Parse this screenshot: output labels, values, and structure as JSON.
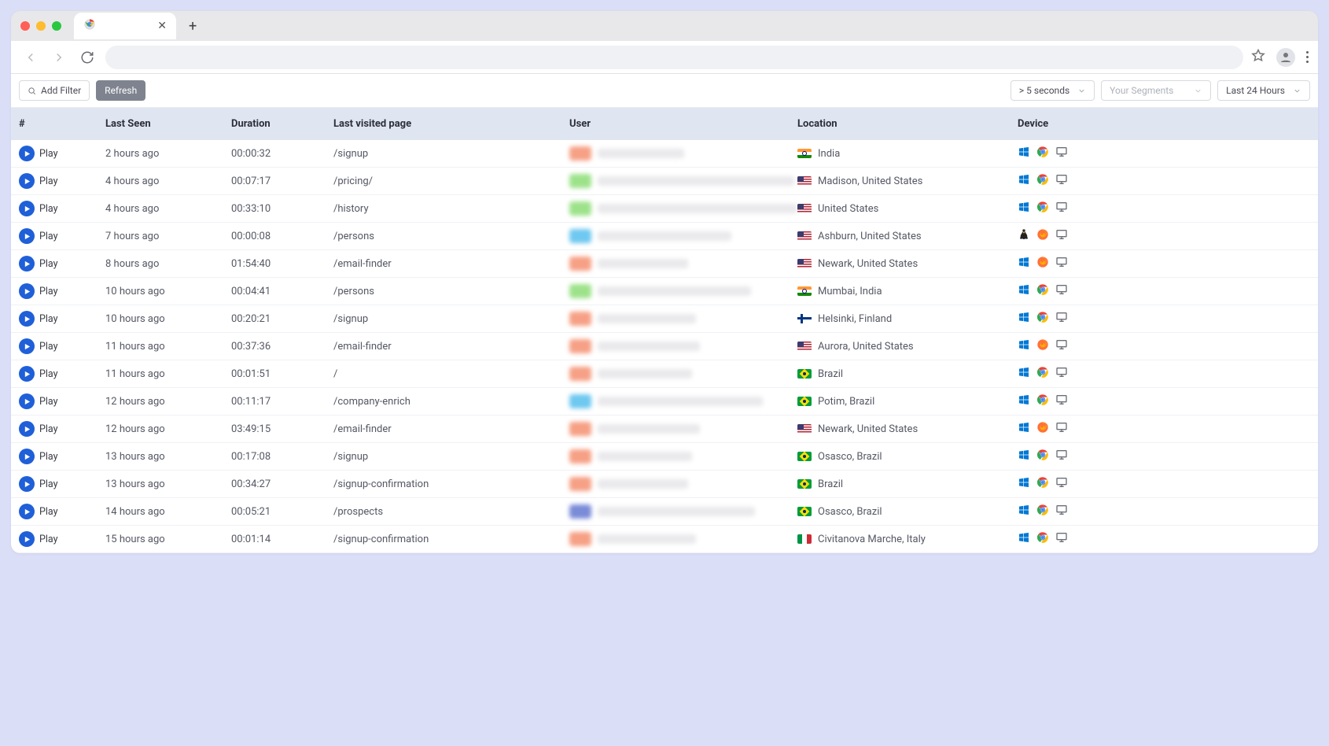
{
  "toolbar": {
    "add_filter": "Add Filter",
    "refresh": "Refresh",
    "duration_filter": "> 5 seconds",
    "segments_placeholder": "Your Segments",
    "time_filter": "Last 24 Hours"
  },
  "columns": {
    "c0": "#",
    "c1": "Last Seen",
    "c2": "Duration",
    "c3": "Last visited page",
    "c4": "User",
    "c5": "Location",
    "c6": "Device"
  },
  "play_label": "Play",
  "rows": [
    {
      "last_seen": "2 hours ago",
      "duration": "00:00:32",
      "page": "/signup",
      "user_color": "#f6a085",
      "user_width": 110,
      "flag": "in",
      "location": "India",
      "os": "windows",
      "browser": "chrome"
    },
    {
      "last_seen": "4 hours ago",
      "duration": "00:07:17",
      "page": "/pricing/",
      "user_color": "#9de28a",
      "user_width": 250,
      "flag": "us",
      "location": "Madison, United States",
      "os": "windows",
      "browser": "chrome"
    },
    {
      "last_seen": "4 hours ago",
      "duration": "00:33:10",
      "page": "/history",
      "user_color": "#9de28a",
      "user_width": 255,
      "flag": "us",
      "location": "United States",
      "os": "windows",
      "browser": "chrome"
    },
    {
      "last_seen": "7 hours ago",
      "duration": "00:00:08",
      "page": "/persons",
      "user_color": "#6ec8f0",
      "user_width": 170,
      "flag": "us",
      "location": "Ashburn, United States",
      "os": "linux",
      "browser": "firefox"
    },
    {
      "last_seen": "8 hours ago",
      "duration": "01:54:40",
      "page": "/email-finder",
      "user_color": "#f6a085",
      "user_width": 115,
      "flag": "us",
      "location": "Newark, United States",
      "os": "windows",
      "browser": "firefox"
    },
    {
      "last_seen": "10 hours ago",
      "duration": "00:04:41",
      "page": "/persons",
      "user_color": "#9de28a",
      "user_width": 195,
      "flag": "in",
      "location": "Mumbai, India",
      "os": "windows",
      "browser": "chrome"
    },
    {
      "last_seen": "10 hours ago",
      "duration": "00:20:21",
      "page": "/signup",
      "user_color": "#f6a085",
      "user_width": 125,
      "flag": "fi",
      "location": "Helsinki, Finland",
      "os": "windows",
      "browser": "chrome"
    },
    {
      "last_seen": "11 hours ago",
      "duration": "00:37:36",
      "page": "/email-finder",
      "user_color": "#f6a085",
      "user_width": 130,
      "flag": "us",
      "location": "Aurora, United States",
      "os": "windows",
      "browser": "firefox"
    },
    {
      "last_seen": "11 hours ago",
      "duration": "00:01:51",
      "page": "/",
      "user_color": "#f6a085",
      "user_width": 120,
      "flag": "br",
      "location": "Brazil",
      "os": "windows",
      "browser": "chrome"
    },
    {
      "last_seen": "12 hours ago",
      "duration": "00:11:17",
      "page": "/company-enrich",
      "user_color": "#6ec8f0",
      "user_width": 210,
      "flag": "br",
      "location": "Potim, Brazil",
      "os": "windows",
      "browser": "chrome"
    },
    {
      "last_seen": "12 hours ago",
      "duration": "03:49:15",
      "page": "/email-finder",
      "user_color": "#f6a085",
      "user_width": 130,
      "flag": "us",
      "location": "Newark, United States",
      "os": "windows",
      "browser": "firefox"
    },
    {
      "last_seen": "13 hours ago",
      "duration": "00:17:08",
      "page": "/signup",
      "user_color": "#f6a085",
      "user_width": 120,
      "flag": "br",
      "location": "Osasco, Brazil",
      "os": "windows",
      "browser": "chrome"
    },
    {
      "last_seen": "13 hours ago",
      "duration": "00:34:27",
      "page": "/signup-confirmation",
      "user_color": "#f6a085",
      "user_width": 115,
      "flag": "br",
      "location": "Brazil",
      "os": "windows",
      "browser": "chrome"
    },
    {
      "last_seen": "14 hours ago",
      "duration": "00:05:21",
      "page": "/prospects",
      "user_color": "#7a8bd8",
      "user_width": 200,
      "flag": "br",
      "location": "Osasco, Brazil",
      "os": "windows",
      "browser": "chrome"
    },
    {
      "last_seen": "15 hours ago",
      "duration": "00:01:14",
      "page": "/signup-confirmation",
      "user_color": "#f6a085",
      "user_width": 125,
      "flag": "it",
      "location": "Civitanova Marche, Italy",
      "os": "windows",
      "browser": "chrome"
    }
  ]
}
